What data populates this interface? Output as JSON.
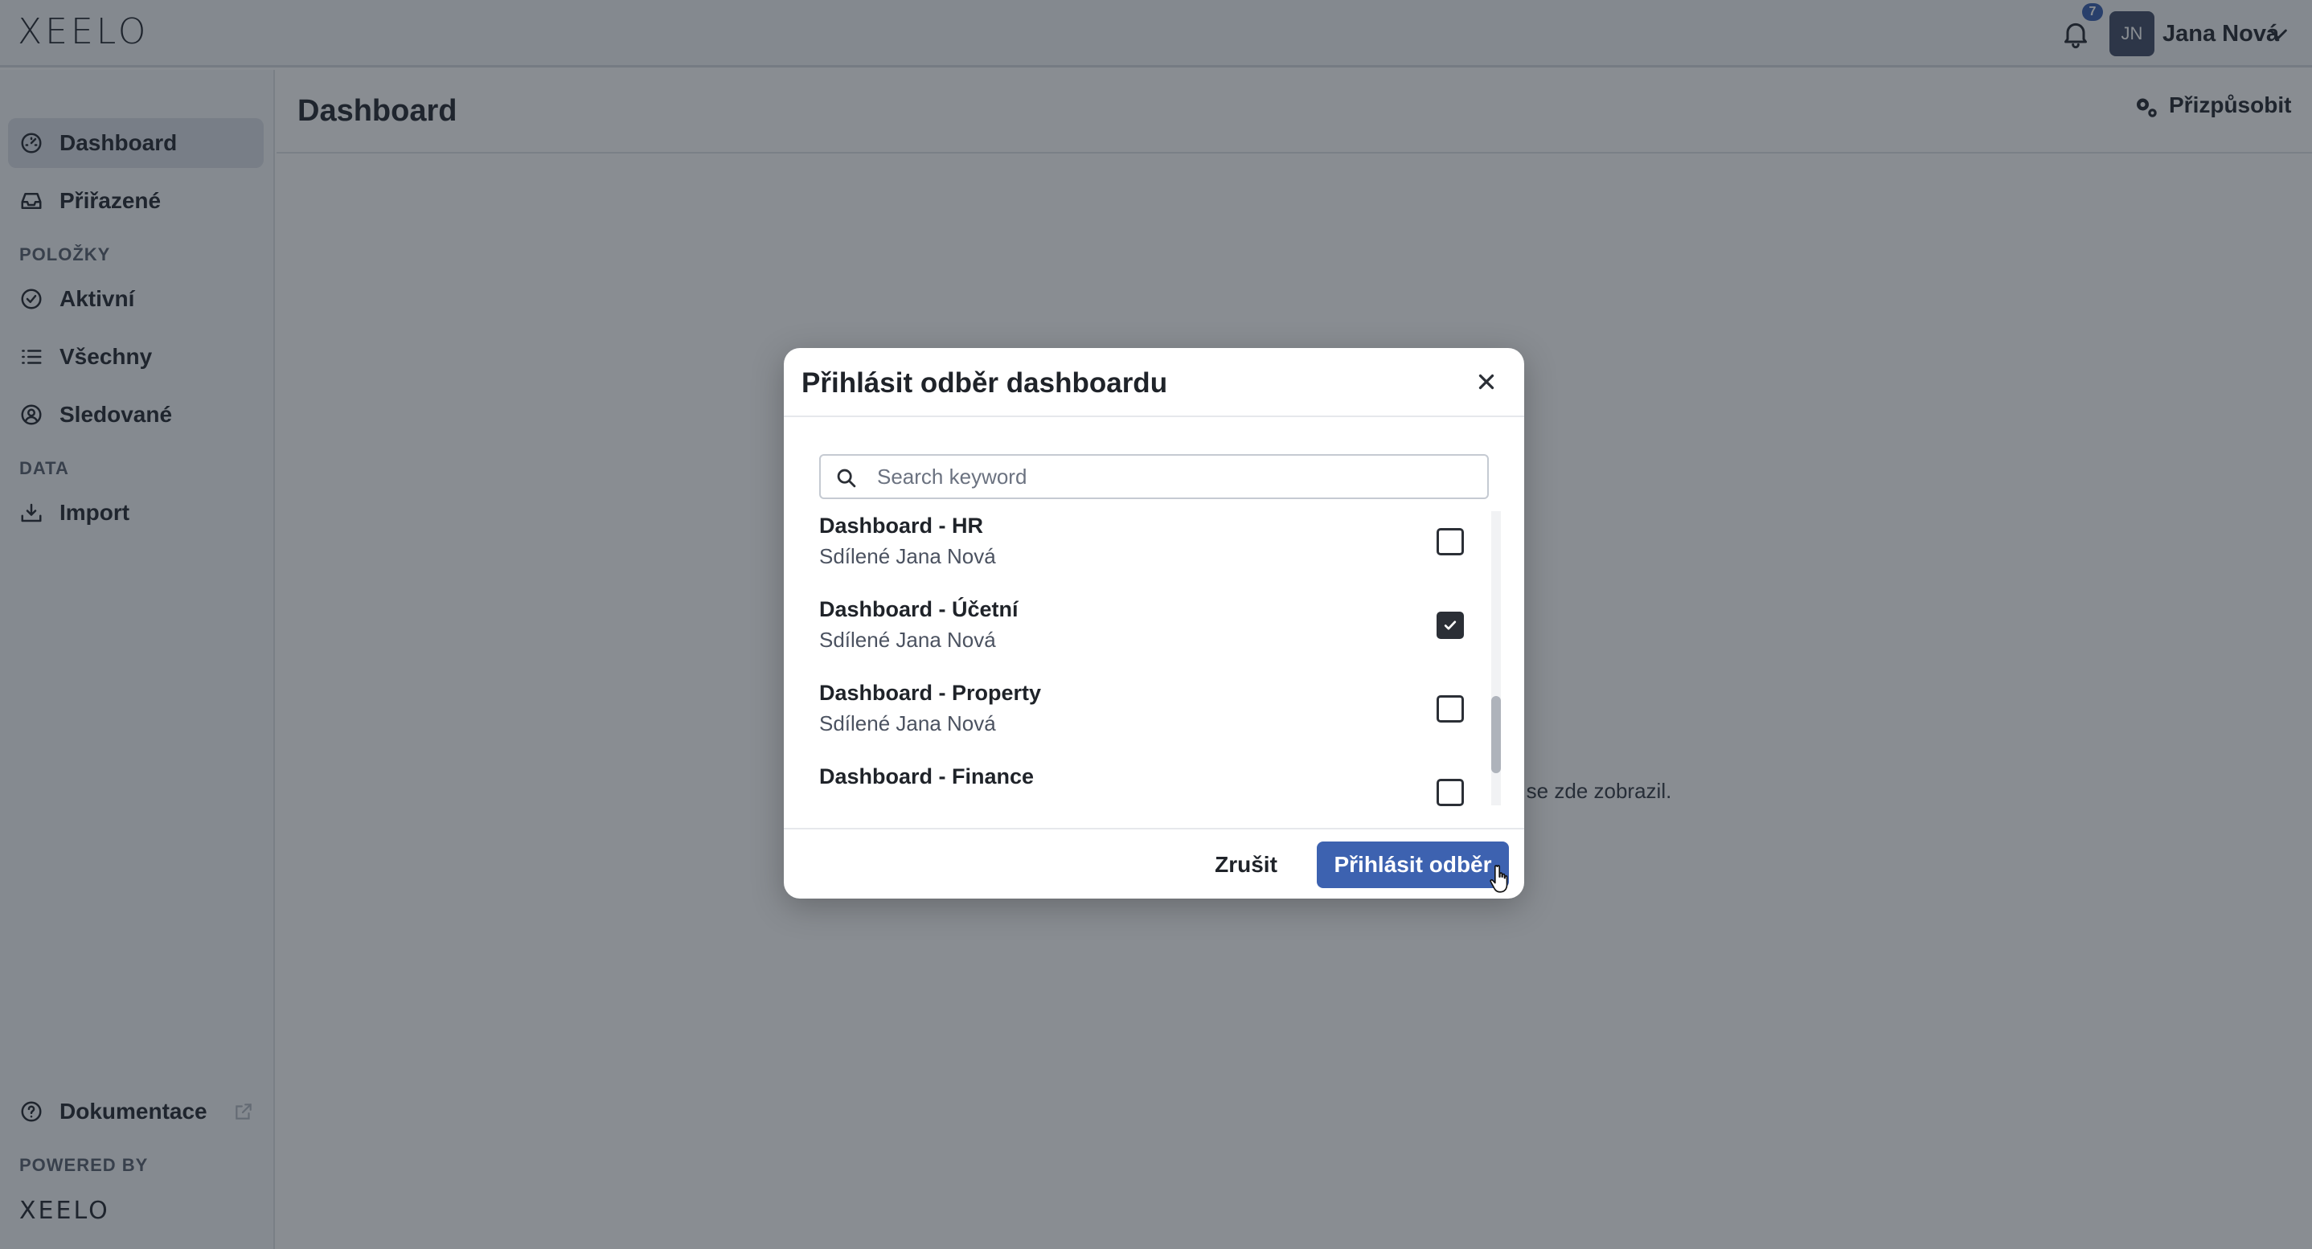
{
  "app": {
    "logo": "XEELO"
  },
  "topbar": {
    "notification_count": "7",
    "avatar_initials": "JN",
    "user_name": "Jana Nová"
  },
  "sidebar": {
    "items": [
      {
        "label": "Dashboard",
        "icon": "gauge-icon",
        "active": true
      },
      {
        "label": "Přiřazené",
        "icon": "inbox-icon"
      }
    ],
    "section_items": "POLOŽKY",
    "item_links": [
      {
        "label": "Aktivní",
        "icon": "check-circle-icon"
      },
      {
        "label": "Všechny",
        "icon": "list-icon"
      },
      {
        "label": "Sledované",
        "icon": "user-circle-icon"
      }
    ],
    "section_data": "DATA",
    "data_links": [
      {
        "label": "Import",
        "icon": "download-icon"
      }
    ],
    "docs_label": "Dokumentace",
    "powered_by": "POWERED BY",
    "powered_logo": "XEELO"
  },
  "page": {
    "title": "Dashboard",
    "customize_label": "Přizpůsobit",
    "empty_text_visible": "by se zde zobrazil."
  },
  "modal": {
    "title": "Přihlásit odběr dashboardu",
    "search_placeholder": "Search keyword",
    "items": [
      {
        "title": "Dashboard - HR",
        "subtitle": "Sdílené Jana Nová",
        "checked": false
      },
      {
        "title": "Dashboard - Účetní",
        "subtitle": "Sdílené Jana Nová",
        "checked": true
      },
      {
        "title": "Dashboard - Property",
        "subtitle": "Sdílené Jana Nová",
        "checked": false
      },
      {
        "title": "Dashboard - Finance",
        "subtitle": "",
        "checked": false
      }
    ],
    "cancel_label": "Zrušit",
    "submit_label": "Přihlásit odběr"
  },
  "colors": {
    "primary": "#3d62b0",
    "overlay": "rgba(20,27,38,0.5)",
    "active_nav": "#dde1e8"
  }
}
